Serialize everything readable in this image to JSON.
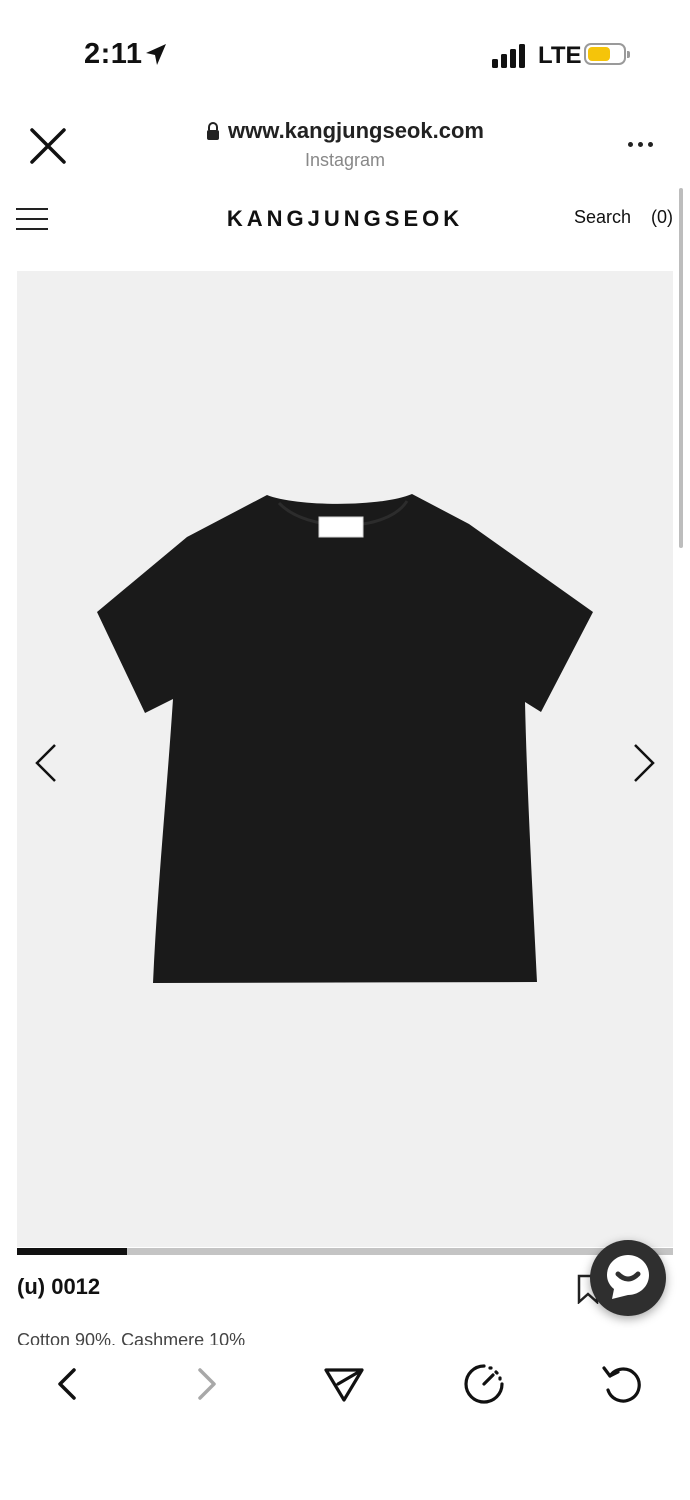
{
  "status_bar": {
    "time": "2:11",
    "network": "LTE",
    "battery_color": "#f5c40a",
    "icons": [
      "location-arrow-icon",
      "signal-icon",
      "battery-icon"
    ]
  },
  "browser": {
    "url": "www.kangjungseok.com",
    "source": "Instagram",
    "icons": [
      "close-icon",
      "lock-icon",
      "more-icon"
    ]
  },
  "site": {
    "brand": "KANGJUNGSEOK",
    "search_label": "Search",
    "cart_label": "(0)"
  },
  "product": {
    "name": "(u) 0012",
    "material": "Cotton 90%, Cashmere 10%",
    "image_subject": "black t-shirt",
    "image_progress": 0.167,
    "background_color": "#f0f0f0"
  },
  "toolbar": {
    "icons": [
      "back-icon",
      "forward-icon",
      "share-icon",
      "speed-icon",
      "reload-icon"
    ]
  },
  "colors": {
    "text": "#111111",
    "chat_button": "#2f2f2f",
    "progress_fill": "#111111",
    "progress_track": "#c4c4c4"
  }
}
